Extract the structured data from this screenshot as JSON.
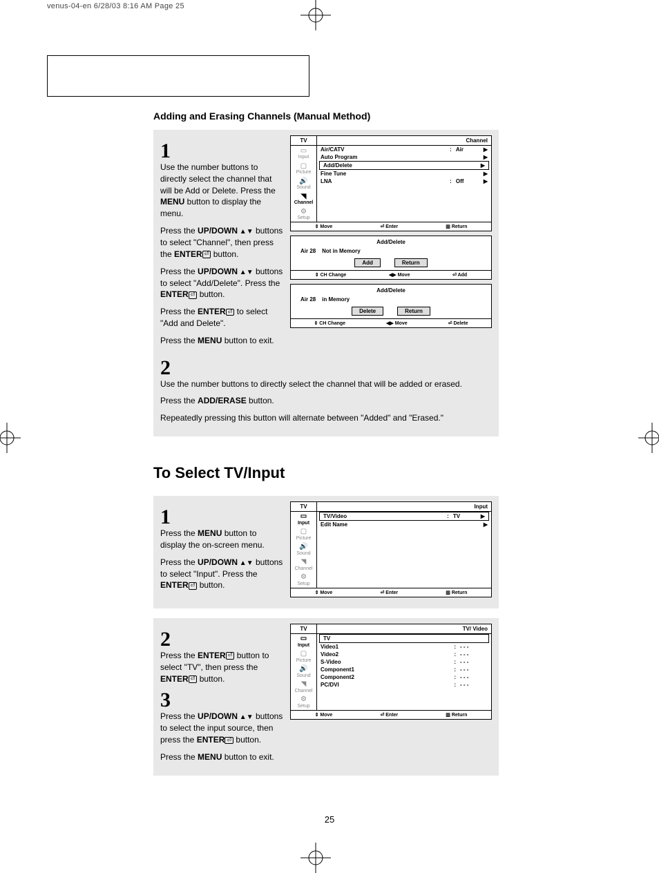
{
  "crop": {
    "header": "venus-04-en  6/28/03  8:16 AM  Page 25"
  },
  "page_number": "25",
  "section1": {
    "title": "Adding and Erasing Channels (Manual Method)",
    "step1": {
      "num": "1",
      "p1a": "Use the number buttons to directly select the channel that will be Add or Delete. Press the ",
      "p1b_bold": "MENU",
      "p1c": " button to display the menu.",
      "p2a": "Press the ",
      "p2b_bold": "UP/DOWN",
      "p2c": " buttons to select \"Channel\", then press the ",
      "p2d_bold": "ENTER",
      "p2e": " button.",
      "p3a": "Press the ",
      "p3b_bold": "UP/DOWN",
      "p3c": " buttons to select \"Add/Delete\". Press the ",
      "p3d_bold": "ENTER",
      "p3e": " button.",
      "p4a": "Press the ",
      "p4b_bold": "ENTER",
      "p4c": " to select \"Add and Delete\".",
      "p5a": "Press the ",
      "p5b_bold": "MENU",
      "p5c": " button to exit."
    },
    "osd1": {
      "hdr_left": "TV",
      "hdr_right": "Channel",
      "sidebar": [
        "Input",
        "Picture",
        "Sound",
        "Channel",
        "Setup"
      ],
      "rows": [
        {
          "label": "Air/CATV",
          "sep": ":",
          "val": "Air",
          "ar": "▶"
        },
        {
          "label": "Auto Program",
          "sep": "",
          "val": "",
          "ar": "▶"
        },
        {
          "label": "Add/Delete",
          "sep": "",
          "val": "",
          "ar": "▶",
          "boxed": true
        },
        {
          "label": "Fine Tune",
          "sep": "",
          "val": "",
          "ar": "▶"
        },
        {
          "label": "LNA",
          "sep": ":",
          "val": "Off",
          "ar": "▶"
        }
      ],
      "footer": [
        "⇕ Move",
        "⏎ Enter",
        "▥ Return"
      ]
    },
    "osd2": {
      "title": "Add/Delete",
      "status_l": "Air 28",
      "status_r": "Not in Memory",
      "btn1": "Add",
      "btn2": "Return",
      "hints": [
        "⇕ CH Change",
        "◀▶ Move",
        "⏎ Add"
      ]
    },
    "osd3": {
      "title": "Add/Delete",
      "status_l": "Air 28",
      "status_r": "in Memory",
      "btn1": "Delete",
      "btn2": "Return",
      "hints": [
        "⇕ CH Change",
        "◀▶ Move",
        "⏎ Delete"
      ]
    },
    "step2": {
      "num": "2",
      "p1": "Use the number buttons to directly select the channel that will be added or erased.",
      "p2a": "Press the ",
      "p2b_bold": "ADD/ERASE",
      "p2c": " button.",
      "p3": "Repeatedly pressing this button will alternate between \"Added\" and \"Erased.\""
    }
  },
  "section2": {
    "title": "To Select TV/Input",
    "step1": {
      "num": "1",
      "p1a": "Press the ",
      "p1b_bold": "MENU",
      "p1c": " button to display the on-screen menu.",
      "p2a": "Press the ",
      "p2b_bold": "UP/DOWN",
      "p2c": " buttons to select \"Input\". Press the ",
      "p2d_bold": "ENTER",
      "p2e": " button."
    },
    "osd4": {
      "hdr_left": "TV",
      "hdr_right": "Input",
      "sidebar": [
        "Input",
        "Picture",
        "Sound",
        "Channel",
        "Setup"
      ],
      "rows": [
        {
          "label": "TV/Video",
          "sep": ":",
          "val": "TV",
          "ar": "▶",
          "boxed": true
        },
        {
          "label": "Edit Name",
          "sep": "",
          "val": "",
          "ar": "▶"
        }
      ],
      "footer": [
        "⇕ Move",
        "⏎ Enter",
        "▥ Return"
      ]
    },
    "step2": {
      "num": "2",
      "p1a": "Press the ",
      "p1b_bold": "ENTER",
      "p1c": "  button to select \"TV\", then press the ",
      "p1d_bold": "ENTER",
      "p1e": "   button."
    },
    "osd5": {
      "hdr_left": "TV",
      "hdr_right": "TV/ Video",
      "sidebar": [
        "Input",
        "Picture",
        "Sound",
        "Channel",
        "Setup"
      ],
      "rows": [
        {
          "label": "TV",
          "sep": "",
          "val": "",
          "ar": "",
          "boxed": true
        },
        {
          "label": "Video1",
          "sep": ":",
          "val": "- - -",
          "ar": ""
        },
        {
          "label": "Video2",
          "sep": ":",
          "val": "- - -",
          "ar": ""
        },
        {
          "label": "S-Video",
          "sep": ":",
          "val": "- - -",
          "ar": ""
        },
        {
          "label": "Component1",
          "sep": ":",
          "val": "- - -",
          "ar": ""
        },
        {
          "label": "Component2",
          "sep": ":",
          "val": "- - -",
          "ar": ""
        },
        {
          "label": "PC/DVI",
          "sep": ":",
          "val": "- - -",
          "ar": ""
        }
      ],
      "footer": [
        "⇕ Move",
        "⏎ Enter",
        "▥ Return"
      ]
    },
    "step3": {
      "num": "3",
      "p1a": "Press the ",
      "p1b_bold": "UP/DOWN",
      "p1c": " buttons to select the input source, then press the ",
      "p1d_bold": "ENTER",
      "p1e": " button.",
      "p2a": "Press the ",
      "p2b_bold": "MENU",
      "p2c": " button to exit."
    }
  }
}
